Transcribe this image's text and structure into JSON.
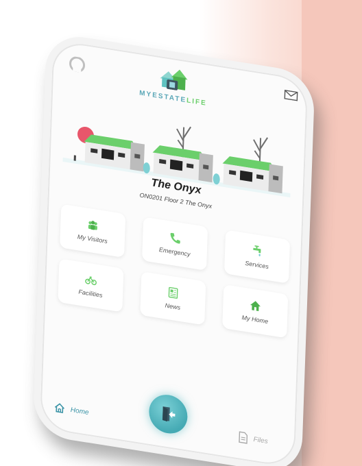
{
  "app": {
    "logo_text_part1": "MYESTATE",
    "logo_text_part2": "LIFE"
  },
  "estate": {
    "name": "The Onyx",
    "address": "ON0201 Floor 2 The Onyx"
  },
  "tiles": [
    {
      "label": "My Visitors",
      "icon": "visitors-icon"
    },
    {
      "label": "Emergency",
      "icon": "phone-icon"
    },
    {
      "label": "Services",
      "icon": "tap-icon"
    },
    {
      "label": "Facilities",
      "icon": "bicycle-icon"
    },
    {
      "label": "News",
      "icon": "newspaper-icon"
    },
    {
      "label": "My Home",
      "icon": "home-icon"
    }
  ],
  "nav": {
    "home_label": "Home",
    "files_label": "Files"
  },
  "colors": {
    "accent_teal": "#45aab4",
    "accent_green": "#6bcf6b",
    "background_pink": "#f5c7bb"
  }
}
